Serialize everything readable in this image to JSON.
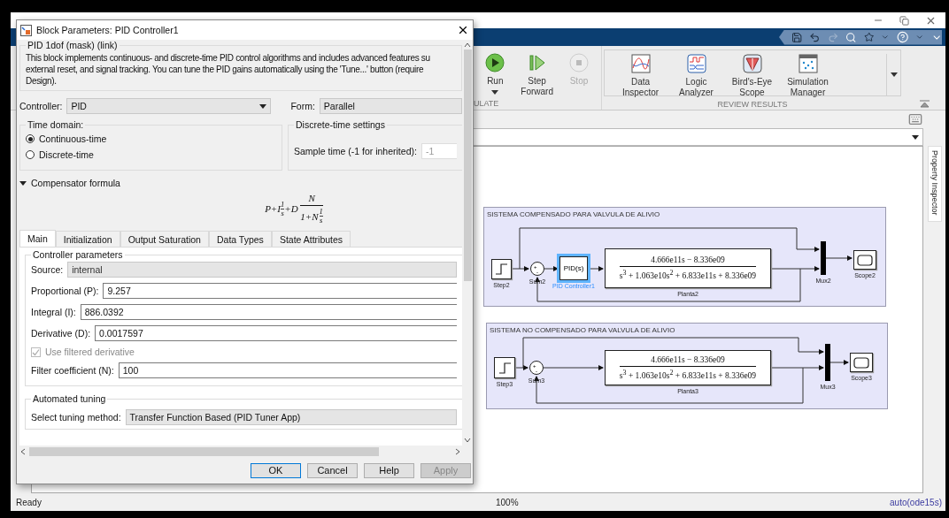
{
  "ribbon": {
    "simulate": {
      "label": "ULATE",
      "buttons": [
        {
          "kind": "run",
          "label_lines": [
            "Run"
          ],
          "disabled": false,
          "has_menu": true
        },
        {
          "kind": "step",
          "label_lines": [
            "Step",
            "Forward"
          ],
          "disabled": false,
          "has_menu": false
        },
        {
          "kind": "stop",
          "label_lines": [
            "Stop"
          ],
          "disabled": true,
          "has_menu": false
        }
      ]
    },
    "review": {
      "label": "REVIEW RESULTS",
      "buttons": [
        {
          "kind": "inspector",
          "label_lines": [
            "Data",
            "Inspector"
          ]
        },
        {
          "kind": "logic",
          "label_lines": [
            "Logic",
            "Analyzer"
          ]
        },
        {
          "kind": "birdseye",
          "label_lines": [
            "Bird's-Eye",
            "Scope"
          ]
        },
        {
          "kind": "manager",
          "label_lines": [
            "Simulation",
            "Manager"
          ]
        }
      ]
    }
  },
  "canvas": {
    "areas": [
      {
        "title": "SISTEMA COMPENSADO PARA VALVULA DE ALIVIO",
        "blocks": [
          {
            "kind": "step",
            "label": "Step2"
          },
          {
            "kind": "sum",
            "label": "Sum2",
            "signs": [
              "+",
              "-"
            ]
          },
          {
            "kind": "pid",
            "text": "PID(s)",
            "label": "PID Controller1",
            "selected": true
          },
          {
            "kind": "tf",
            "numerator": "4.666e11s − 8.336e09",
            "denominator": "s$^{3}$ + 1.063e10s$^{2}$ + 6.833e11s + 8.336e09",
            "label": "Planta2"
          },
          {
            "kind": "mux",
            "label": "Mux2"
          },
          {
            "kind": "scope",
            "label": "Scope2"
          }
        ]
      },
      {
        "title": "SISTEMA NO COMPENSADO PARA VALVULA DE ALIVIO",
        "blocks": [
          {
            "kind": "step",
            "label": "Step3"
          },
          {
            "kind": "sum",
            "label": "Sum3",
            "signs": [
              "+",
              "-"
            ]
          },
          {
            "kind": "tf",
            "numerator": "4.666e11s − 8.336e09",
            "denominator": "s$^{3}$ + 1.063e10s$^{2}$ + 6.833e11s + 8.336e09",
            "label": "Planta3"
          },
          {
            "kind": "mux",
            "label": "Mux3"
          },
          {
            "kind": "scope",
            "label": "Scope3"
          }
        ]
      }
    ]
  },
  "property_inspector": {
    "label": "Property Inspector"
  },
  "status_bar": {
    "status": "Ready",
    "zoom": "100%",
    "solver": "auto(ode15s)"
  },
  "dialog": {
    "title": "Block Parameters: PID Controller1",
    "mask_title": "PID 1dof (mask) (link)",
    "description_lines": [
      "This block implements continuous- and discrete-time PID control algorithms and includes advanced features su",
      "external reset, and signal tracking. You can tune the PID gains automatically using the 'Tune...' button (require",
      "Design)."
    ],
    "controller": {
      "label": "Controller:",
      "value": "PID"
    },
    "form": {
      "label": "Form:",
      "value": "Parallel"
    },
    "time_domain": {
      "title": "Time domain:",
      "options": [
        {
          "label": "Continuous-time",
          "selected": true
        },
        {
          "label": "Discrete-time",
          "selected": false
        }
      ]
    },
    "discrete_settings": {
      "title": "Discrete-time settings",
      "label": "Sample time (-1 for inherited):",
      "value": "-1",
      "disabled": true
    },
    "compensator": {
      "label": "Compensator formula",
      "expanded": true,
      "formula": {
        "lead": "P+I",
        "int_num": "1",
        "int_den": "s",
        "mid": "+D",
        "d_num": "N",
        "d_den_lead": "1+N",
        "d_den_num": "1",
        "d_den_den": "s"
      }
    },
    "tabs": [
      {
        "label": "Main",
        "selected": true
      },
      {
        "label": "Initialization",
        "selected": false
      },
      {
        "label": "Output Saturation",
        "selected": false
      },
      {
        "label": "Data Types",
        "selected": false
      },
      {
        "label": "State Attributes",
        "selected": false
      }
    ],
    "parameters": {
      "title": "Controller parameters",
      "fields": [
        {
          "kind": "select",
          "label": "Source:",
          "value": "internal"
        },
        {
          "kind": "input",
          "label": "Proportional (P):",
          "value": "9.257"
        },
        {
          "kind": "input",
          "label": "Integral (I):",
          "value": "886.0392"
        },
        {
          "kind": "input",
          "label": "Derivative (D):",
          "value": "0.0017597"
        },
        {
          "kind": "checkbox",
          "label": "Use filtered derivative",
          "checked": true,
          "disabled": true
        },
        {
          "kind": "input",
          "label": "Filter coefficient (N):",
          "value": "100"
        }
      ]
    },
    "tuning": {
      "title": "Automated tuning",
      "label": "Select tuning method:",
      "value": "Transfer Function Based (PID Tuner App)"
    },
    "buttons": [
      {
        "label": "OK",
        "focused": true,
        "disabled": false
      },
      {
        "label": "Cancel",
        "focused": false,
        "disabled": false
      },
      {
        "label": "Help",
        "focused": false,
        "disabled": false
      },
      {
        "label": "Apply",
        "focused": false,
        "disabled": true
      }
    ]
  }
}
